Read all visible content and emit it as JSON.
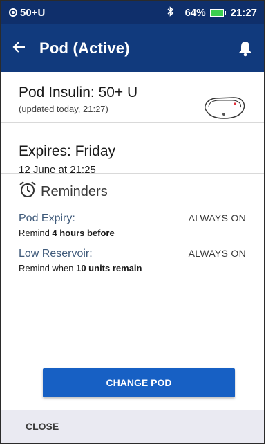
{
  "status_bar": {
    "pod_insulin": "50+U",
    "battery_percent": "64%",
    "time": "21:27",
    "icons": [
      "pod-icon",
      "bluetooth-icon",
      "battery-icon"
    ],
    "battery_color": "#3ccf4e"
  },
  "header": {
    "title": "Pod (Active)",
    "back_icon": "back-arrow-icon",
    "bell_icon": "bell-icon",
    "color": "#113a7d"
  },
  "pod_insulin": {
    "label": "Pod Insulin: 50+ U",
    "updated": "(updated today, 21:27)"
  },
  "expires": {
    "label": "Expires: Friday",
    "date": "12 June at 21:25"
  },
  "reminders": {
    "title": "Reminders",
    "icon": "alarm-clock-icon",
    "items": [
      {
        "label": "Pod Expiry:",
        "value": "ALWAYS ON",
        "desc_prefix": "Remind ",
        "desc_bold": "4 hours before",
        "desc_suffix": ""
      },
      {
        "label": "Low Reservoir:",
        "value": "ALWAYS ON",
        "desc_prefix": "Remind when ",
        "desc_bold": "10 units remain",
        "desc_suffix": ""
      }
    ]
  },
  "actions": {
    "change_pod": "CHANGE POD",
    "close": "CLOSE",
    "button_color": "#1760c4"
  }
}
